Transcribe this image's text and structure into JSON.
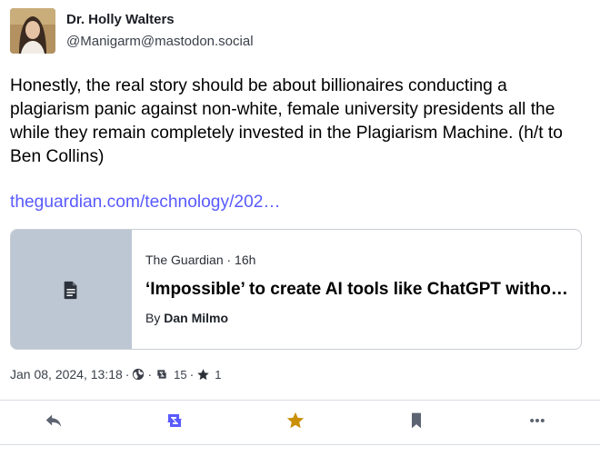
{
  "author": {
    "display_name": "Dr. Holly Walters",
    "handle": "@Manigarm@mastodon.social"
  },
  "status": {
    "text": "Honestly, the real story should be about billionaires conducting a plagiarism panic against non-white, female university presidents all the while they remain completely invested in the Plagiarism Machine. (h/t to Ben Collins)",
    "link_text": "theguardian.com/technology/202…"
  },
  "card": {
    "meta": "The Guardian · 16h",
    "title": "‘Impossible’ to create AI tools like ChatGPT without copyrighted material, OpenAI says",
    "byline_prefix": "By ",
    "byline_author": "Dan Milmo",
    "thumbnail_icon": "document-icon"
  },
  "meta": {
    "timestamp": "Jan 08, 2024, 13:18",
    "sep1": "·",
    "visibility_icon": "globe-icon",
    "sep2": "·",
    "boost_icon": "boost-icon",
    "boost_count": "15",
    "sep3": "·",
    "star_icon": "star-icon",
    "favourite_count": "1"
  },
  "actions": {
    "reply_icon": "reply-icon",
    "boost_icon": "boost-icon",
    "favourite_icon": "star-icon",
    "bookmark_icon": "bookmark-icon",
    "more_icon": "more-icon"
  },
  "colors": {
    "link": "#595aff",
    "boost_active": "#595aff",
    "favourite_active": "#ca8f04",
    "icon_default": "#5c6371"
  }
}
